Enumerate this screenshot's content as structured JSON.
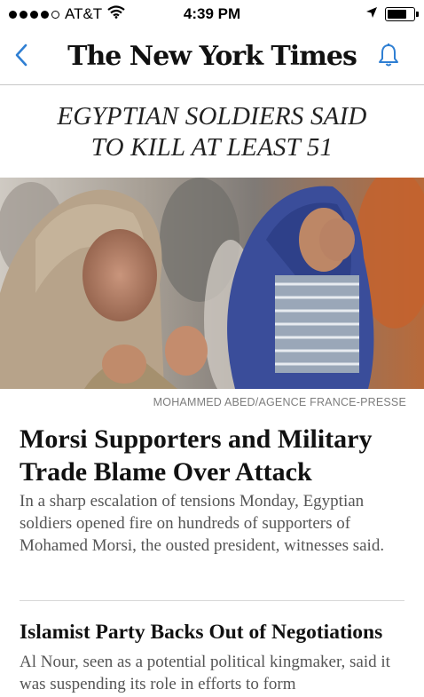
{
  "status_bar": {
    "carrier": "AT&T",
    "time": "4:39 PM",
    "signal_bars": 5,
    "signal_filled": 4,
    "battery_level": 0.75
  },
  "nav": {
    "masthead": "The New York Times",
    "back_icon": "chevron-left-icon",
    "bell_icon": "bell-icon",
    "accent_color": "#2f7fd3"
  },
  "top_story": {
    "kicker": "EGYPTIAN SOLDIERS SAID TO KILL AT LEAST 51",
    "photo_credit": "MOHAMMED ABED/AGENCE FRANCE-PRESSE",
    "headline": "Morsi Supporters and Military Trade Blame Over Attack",
    "summary": "In a sharp escalation of tensions Monday, Egyptian soldiers opened fire on hundreds of supporters of Mohamed Morsi, the ousted president, witnesses said."
  },
  "second_story": {
    "headline": "Islamist Party Backs Out of Negotiations",
    "summary": "Al Nour, seen as a potential political kingmaker, said it was suspending its role in efforts to form"
  }
}
